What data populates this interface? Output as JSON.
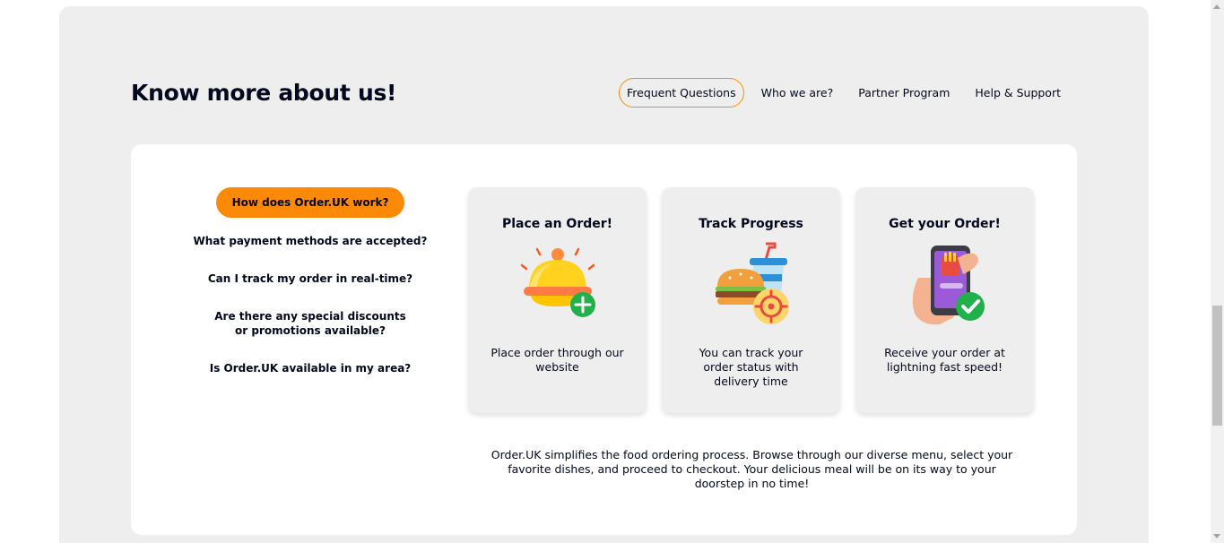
{
  "heading": "Know more about us!",
  "tabs": [
    {
      "label": "Frequent Questions",
      "active": true
    },
    {
      "label": "Who we are?",
      "active": false
    },
    {
      "label": "Partner Program",
      "active": false
    },
    {
      "label": "Help & Support",
      "active": false
    }
  ],
  "faq": [
    {
      "label": "How does Order.UK work?",
      "active": true
    },
    {
      "label": "What payment methods are accepted?",
      "active": false
    },
    {
      "label": "Can I track my order in real-time?",
      "active": false
    },
    {
      "label": "Are there any special discounts or promotions available?",
      "active": false
    },
    {
      "label": "Is Order.UK available in my area?",
      "active": false
    }
  ],
  "cards": [
    {
      "title": "Place an Order!",
      "description": "Place order through our website",
      "icon": "food-cloche-plus-icon"
    },
    {
      "title": "Track Progress",
      "description": "You can track your order status with delivery time",
      "icon": "burger-drink-target-icon"
    },
    {
      "title": "Get your Order!",
      "description": "Receive your order at lightning fast speed!",
      "icon": "phone-checkmark-icon"
    }
  ],
  "summary": "Order.UK simplifies the food ordering process. Browse through our diverse menu, select your favorite dishes, and proceed to checkout. Your delicious meal will be on its way to your doorstep in no time!",
  "colors": {
    "accent": "#FC8A06",
    "section_bg": "#EEEEEE",
    "panel_bg": "#FFFFFF",
    "text": "#03081F",
    "success": "#22B04B"
  }
}
